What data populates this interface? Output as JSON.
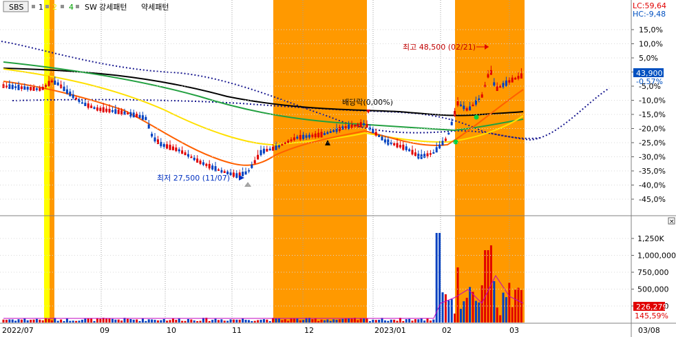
{
  "toolbar": {
    "symbol": "SBS",
    "markers": [
      "1",
      "2",
      "4"
    ],
    "marker_colors": [
      "#000000",
      "#e8e800",
      "#00a000"
    ],
    "indicators": [
      "SW",
      "강세패턴",
      "약세패턴"
    ]
  },
  "corner_info": {
    "lc": "LC:59,64",
    "hc": "HC:-9,48"
  },
  "price_axis": {
    "ticks": [
      "15,0%",
      "10,0%",
      "5,0%",
      "0,0%",
      "-5,0%",
      "-10,0%",
      "-15,0%",
      "-20,0%",
      "-25,0%",
      "-30,0%",
      "-35,0%",
      "-40,0%",
      "-45,0%"
    ],
    "current_label": "43,900",
    "current_pct": "-0,57%"
  },
  "volume_axis": {
    "ticks": [
      "1,250K",
      "1,000,000",
      "750,000",
      "500,000",
      "250,000"
    ],
    "current_label": "226,279",
    "current_pct": "145,59%"
  },
  "x_axis": {
    "labels": [
      "2022/07",
      "09",
      "10",
      "11",
      "12",
      "2023/01",
      "02",
      "03",
      "03/08"
    ]
  },
  "annotations": {
    "high": "최고 48,500 (02/21)",
    "low": "최저 27,500 (11/07)",
    "dividend": "배당락(0,00%)"
  },
  "colors": {
    "up_candle": "#e00000",
    "down_candle": "#0040c0",
    "highlight_zone": "#ff9900",
    "yellow_zone": "#ffff00",
    "ma_short": "#ff5000",
    "ma_mid": "#ffe000",
    "ma_long_green": "#22a040",
    "ma_longest": "#000000",
    "envelope": "#0000a0",
    "price_badge_bg": "#0050c0",
    "volume_badge_bg": "#e00000",
    "corner_text": "#e00000"
  },
  "chart_data": {
    "type": "candlestick",
    "price_range_pct": [
      -50,
      18
    ],
    "highlight_periods": [
      "2022/12",
      "2023/02-03"
    ],
    "high_value": 48500,
    "low_value": 27500,
    "volume_range": [
      0,
      1400000
    ]
  }
}
